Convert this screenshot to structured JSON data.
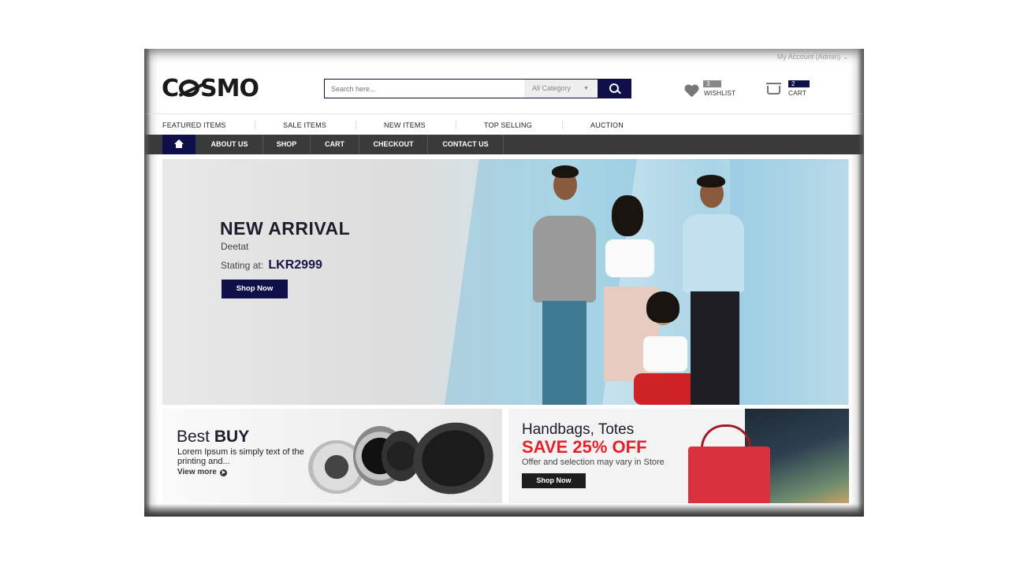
{
  "top_bar": {
    "account": "My Account (Admin)"
  },
  "header": {
    "logo": {
      "pre": "C",
      "post": "SMO"
    },
    "search": {
      "placeholder": "Search here...",
      "category": "All Category"
    },
    "wishlist": {
      "badge": "3 item",
      "label": "WISHLIST"
    },
    "cart": {
      "badge": "2 items",
      "label": "CART"
    }
  },
  "category_nav": [
    "FEATURED ITEMS",
    "SALE ITEMS",
    "NEW ITEMS",
    "TOP SELLING",
    "AUCTION"
  ],
  "main_nav": [
    "ABOUT US",
    "SHOP",
    "CART",
    "CHECKOUT",
    "CONTACT US"
  ],
  "hero": {
    "title": "NEW ARRIVAL",
    "subtitle": "Deetat",
    "price_label": "Stating at:",
    "price": "LKR2999",
    "button": "Shop Now"
  },
  "promo_left": {
    "title_light": "Best",
    "title_bold": "BUY",
    "desc": "Lorem Ipsum is simply text of the printing and...",
    "link": "View more"
  },
  "promo_right": {
    "title": "Handbags, Totes",
    "sale": "SAVE 25% OFF",
    "desc": "Offer and selection may vary in Store",
    "button": "Shop Now"
  },
  "colors": {
    "brand_navy": "#0f0f4a",
    "nav_dark": "#3a3a3a",
    "sale_red": "#e52229"
  }
}
